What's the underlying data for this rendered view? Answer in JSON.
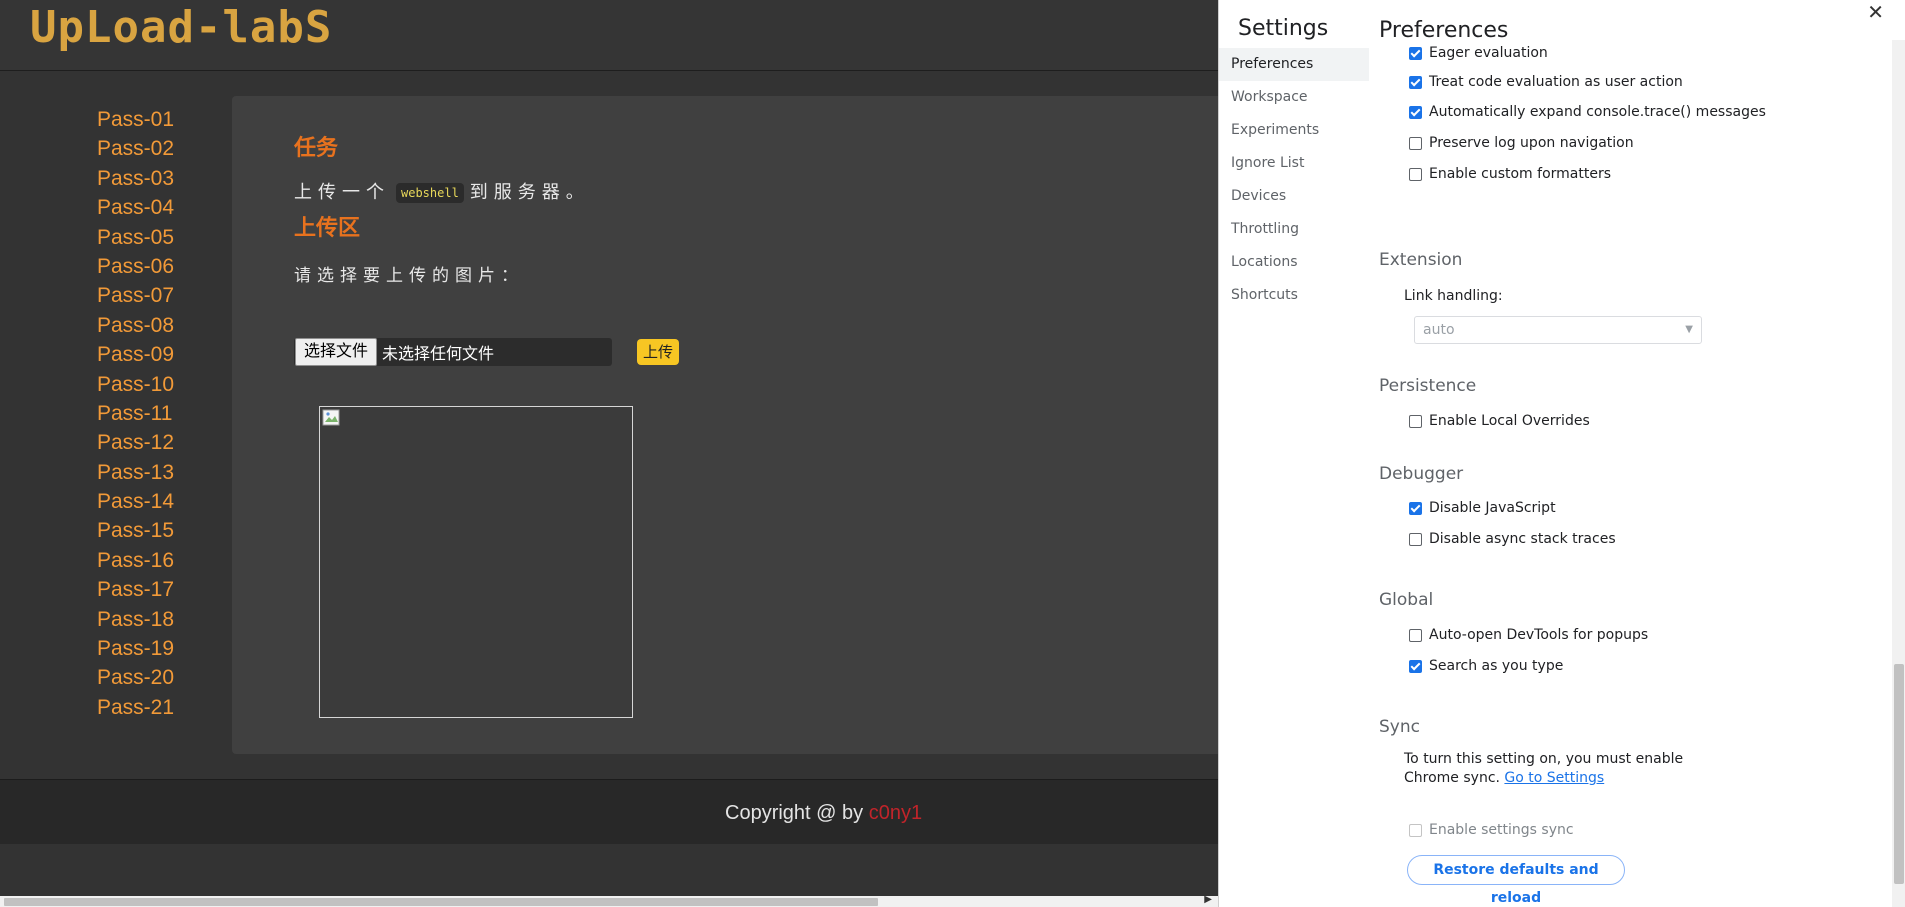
{
  "site": {
    "logo": "UpLoad-labS",
    "nav": [
      "Pass-01",
      "Pass-02",
      "Pass-03",
      "Pass-04",
      "Pass-05",
      "Pass-06",
      "Pass-07",
      "Pass-08",
      "Pass-09",
      "Pass-10",
      "Pass-11",
      "Pass-12",
      "Pass-13",
      "Pass-14",
      "Pass-15",
      "Pass-16",
      "Pass-17",
      "Pass-18",
      "Pass-19",
      "Pass-20",
      "Pass-21"
    ],
    "task_title": "任务",
    "task_text_before": "上传一个",
    "task_code": "webshell",
    "task_text_after": "到服务器。",
    "upload_title": "上传区",
    "upload_prompt": "请选择要上传的图片：",
    "choose_file_label": "选择文件",
    "file_status": "未选择任何文件",
    "upload_button": "上传",
    "copyright_prefix": "Copyright @  by",
    "copyright_author": "c0ny1",
    "author_color": "#c0242a"
  },
  "devtools": {
    "settings_title": "Settings",
    "pane_title": "Preferences",
    "nav": [
      {
        "label": "Preferences",
        "active": true
      },
      {
        "label": "Workspace",
        "active": false
      },
      {
        "label": "Experiments",
        "active": false
      },
      {
        "label": "Ignore List",
        "active": false
      },
      {
        "label": "Devices",
        "active": false
      },
      {
        "label": "Throttling",
        "active": false
      },
      {
        "label": "Locations",
        "active": false
      },
      {
        "label": "Shortcuts",
        "active": false
      }
    ],
    "console_options": [
      {
        "label": "Eager evaluation",
        "checked": true
      },
      {
        "label": "Treat code evaluation as user action",
        "checked": true
      },
      {
        "label": "Automatically expand console.trace() messages",
        "checked": true
      },
      {
        "label": "Preserve log upon navigation",
        "checked": false
      },
      {
        "label": "Enable custom formatters",
        "checked": false
      }
    ],
    "extension_title": "Extension",
    "link_handling_label": "Link handling:",
    "link_handling_value": "auto",
    "persistence_title": "Persistence",
    "persistence_options": [
      {
        "label": "Enable Local Overrides",
        "checked": false
      }
    ],
    "debugger_title": "Debugger",
    "debugger_options": [
      {
        "label": "Disable JavaScript",
        "checked": true
      },
      {
        "label": "Disable async stack traces",
        "checked": false
      }
    ],
    "global_title": "Global",
    "global_options": [
      {
        "label": "Auto-open DevTools for popups",
        "checked": false
      },
      {
        "label": "Search as you type",
        "checked": true
      }
    ],
    "sync_title": "Sync",
    "sync_note": "To turn this setting on, you must enable Chrome sync.",
    "sync_link": "Go to Settings",
    "sync_option": {
      "label": "Enable settings sync",
      "checked": false,
      "disabled": true
    },
    "restore_button": "Restore defaults and reload",
    "accent_color": "#1a73e8"
  }
}
